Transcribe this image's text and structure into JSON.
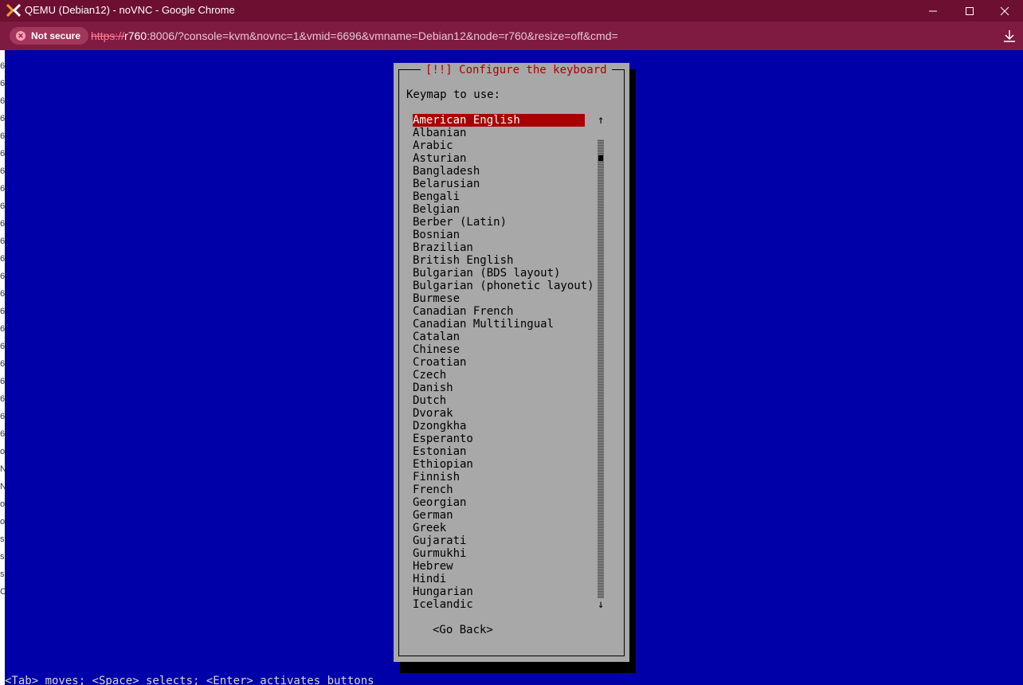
{
  "window": {
    "title": "QEMU (Debian12) - noVNC - Google Chrome",
    "controls": [
      "minimize-icon",
      "maximize-icon",
      "close-icon"
    ],
    "colors": {
      "titlebar": "#6c0f30",
      "addressbar": "#7f1a41"
    }
  },
  "addressbar": {
    "security_label": "Not secure",
    "url_scheme": "https://",
    "url_host": "r760",
    "url_rest": ":8006/?console=kvm&novnc=1&vmid=6696&vmname=Debian12&node=r760&resize=off&cmd="
  },
  "left_strip": [
    "6",
    "6",
    "6",
    "6",
    "6",
    "6",
    "6",
    "6",
    "6",
    "6",
    "6",
    "6",
    "6",
    "6",
    "6",
    "6",
    "6",
    "6",
    "6",
    "6",
    "6",
    "6",
    "o",
    "N",
    "N",
    "o",
    "o",
    "s",
    "s",
    "s",
    "C"
  ],
  "installer": {
    "title": "[!!] Configure the keyboard",
    "prompt": "Keymap to use:",
    "selected_index": 0,
    "keymaps": [
      "American English",
      "Albanian",
      "Arabic",
      "Asturian",
      "Bangladesh",
      "Belarusian",
      "Bengali",
      "Belgian",
      "Berber (Latin)",
      "Bosnian",
      "Brazilian",
      "British English",
      "Bulgarian (BDS layout)",
      "Bulgarian (phonetic layout)",
      "Burmese",
      "Canadian French",
      "Canadian Multilingual",
      "Catalan",
      "Chinese",
      "Croatian",
      "Czech",
      "Danish",
      "Dutch",
      "Dvorak",
      "Dzongkha",
      "Esperanto",
      "Estonian",
      "Ethiopian",
      "Finnish",
      "French",
      "Georgian",
      "German",
      "Greek",
      "Gujarati",
      "Gurmukhi",
      "Hebrew",
      "Hindi",
      "Hungarian",
      "Icelandic"
    ],
    "scroll_up": "↑",
    "scroll_down": "↓",
    "go_back_label": "<Go Back>",
    "help_line": "<Tab> moves; <Space> selects; <Enter> activates buttons",
    "colors": {
      "background": "#0000a8",
      "dialog": "#a8a8a8",
      "highlight": "#a80000"
    }
  }
}
